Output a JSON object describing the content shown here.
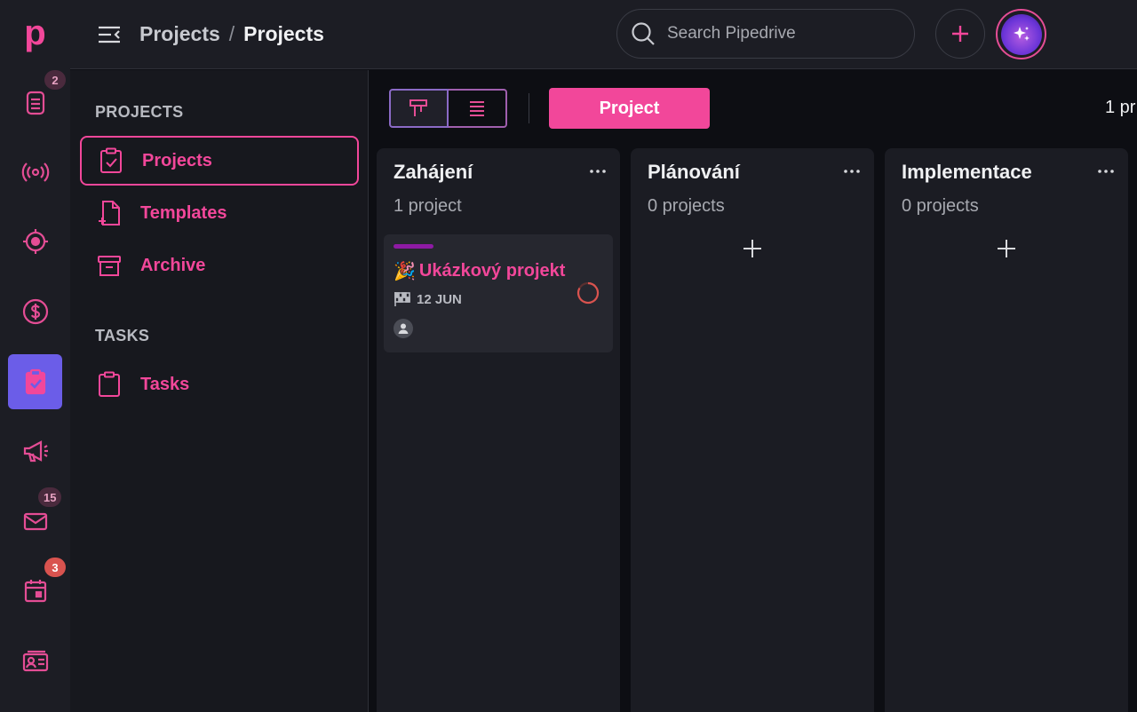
{
  "app": {
    "logo_letter": "p"
  },
  "rail": {
    "items": [
      {
        "name": "leads-inbox",
        "badge": "2"
      },
      {
        "name": "campaigns-broadcast"
      },
      {
        "name": "deals-target"
      },
      {
        "name": "revenue-dollar"
      },
      {
        "name": "projects",
        "active": true
      },
      {
        "name": "marketing-megaphone"
      },
      {
        "name": "mail",
        "badge": "15"
      },
      {
        "name": "calendar",
        "badge": "3"
      },
      {
        "name": "contacts-card"
      }
    ],
    "badges": {
      "leads": "2",
      "mail": "15",
      "calendar": "3"
    }
  },
  "header": {
    "breadcrumb_root": "Projects",
    "breadcrumb_sep": "/",
    "breadcrumb_current": "Projects",
    "search_placeholder": "Search Pipedrive"
  },
  "sidebar": {
    "projects_heading": "PROJECTS",
    "items": [
      {
        "label": "Projects",
        "active": true
      },
      {
        "label": "Templates"
      },
      {
        "label": "Archive"
      }
    ],
    "tasks_heading": "TASKS",
    "tasks_items": [
      {
        "label": "Tasks"
      }
    ]
  },
  "toolbar": {
    "add_project_label": "Project",
    "count_text": "1 pr"
  },
  "board": {
    "columns": [
      {
        "title": "Zahájení",
        "count": "1 project",
        "cards": [
          {
            "emoji": "🎉",
            "title": "Ukázkový projekt",
            "due": "12 JUN",
            "accent": "#8e1aa4"
          }
        ]
      },
      {
        "title": "Plánování",
        "count": "0 projects"
      },
      {
        "title": "Implementace",
        "count": "0 projects"
      }
    ]
  },
  "colors": {
    "accent": "#f2479a",
    "active_rail": "#6b5de8",
    "badge_red": "#d9534f"
  }
}
